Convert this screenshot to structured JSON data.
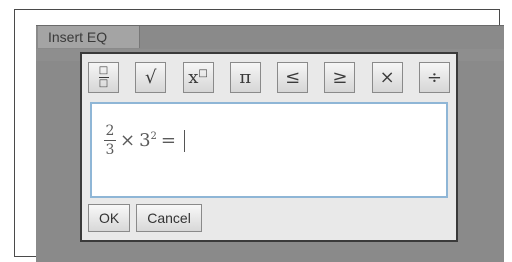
{
  "panel": {
    "tab_label": "Insert EQ"
  },
  "toolbar": {
    "buttons": [
      {
        "name": "fraction"
      },
      {
        "name": "square-root",
        "glyph": "√"
      },
      {
        "name": "exponent",
        "glyph": "x"
      },
      {
        "name": "pi",
        "glyph": "π"
      },
      {
        "name": "less-or-equal",
        "glyph": "≤"
      },
      {
        "name": "greater-or-equal",
        "glyph": "≥"
      },
      {
        "name": "multiply",
        "glyph": "×"
      },
      {
        "name": "divide",
        "glyph": "÷"
      }
    ]
  },
  "editor": {
    "numerator": "2",
    "denominator": "3",
    "times": "×",
    "base": "3",
    "power": "2",
    "equals": "="
  },
  "actions": {
    "ok_label": "OK",
    "cancel_label": "Cancel"
  }
}
